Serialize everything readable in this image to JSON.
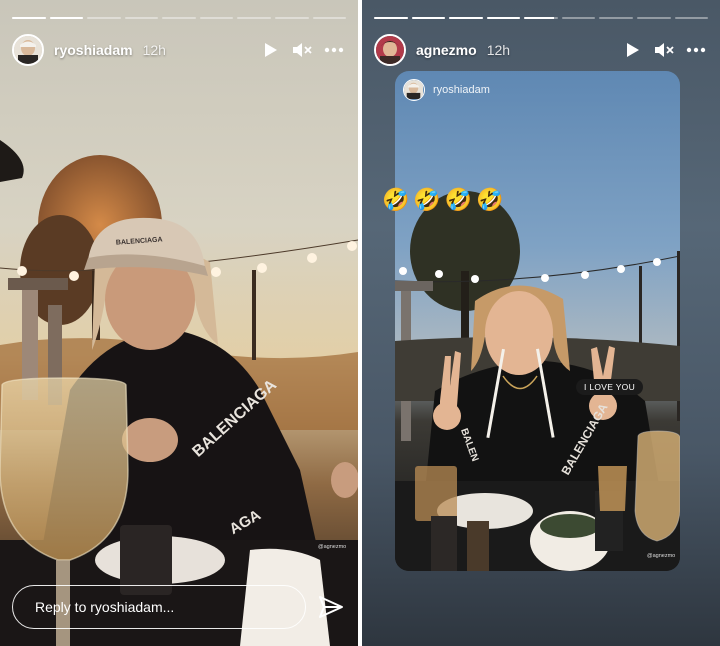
{
  "stories": [
    {
      "id": "left",
      "progress_segments": [
        1,
        1,
        0,
        0,
        0,
        0,
        0,
        0,
        0
      ],
      "username": "ryoshiadam",
      "time_ago": "12h",
      "reply_placeholder": "Reply to ryoshiadam...",
      "watermark": "@agnezmo",
      "icons": [
        "play-icon",
        "mute-icon",
        "more-icon",
        "send-icon"
      ]
    },
    {
      "id": "right",
      "progress_segments": [
        1,
        1,
        1,
        1,
        0.9,
        0,
        0,
        0,
        0
      ],
      "username": "agnezmo",
      "time_ago": "12h",
      "repost": {
        "username": "ryoshiadam",
        "emojis": [
          "🤣",
          "🤣",
          "🤣",
          "🤣"
        ],
        "sticker": "I LOVE YOU",
        "watermark": "@agnezmo"
      },
      "icons": [
        "play-icon",
        "mute-icon",
        "more-icon"
      ]
    }
  ],
  "colors": {
    "progress_track": "rgba(255,255,255,0.4)",
    "progress_fill": "#ffffff",
    "text": "#ffffff"
  }
}
